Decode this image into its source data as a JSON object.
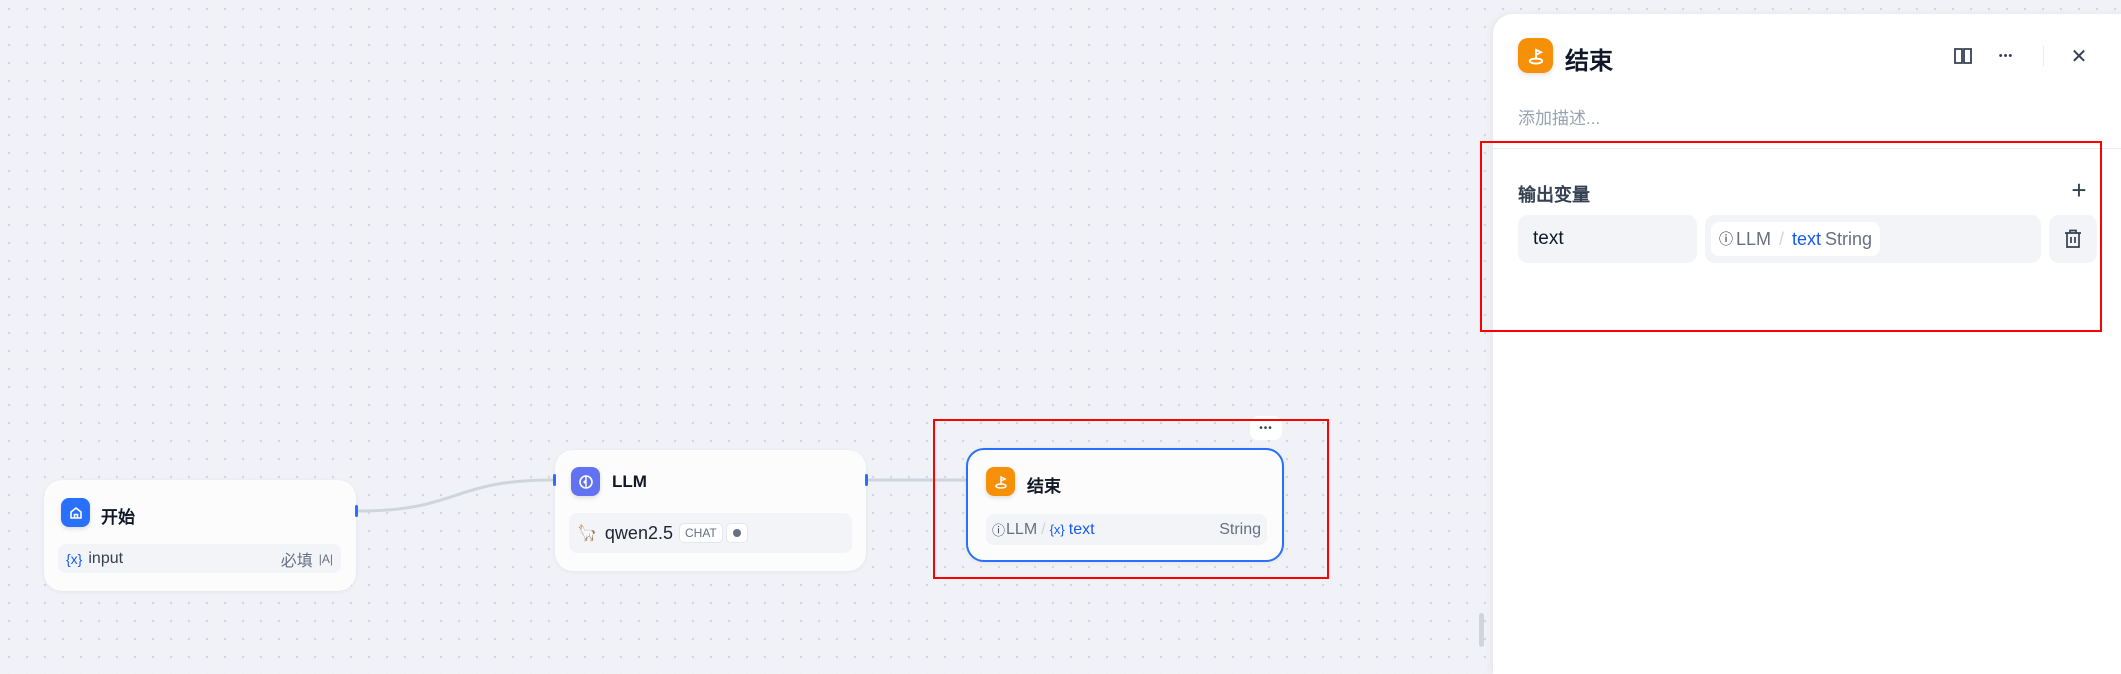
{
  "canvas": {
    "nodes": {
      "start": {
        "title": "开始",
        "icon": "home-icon",
        "color": "#2970ff",
        "variable": {
          "type_icon": "{x}",
          "name": "input",
          "required": "必填",
          "field_type_icon": "|A|"
        }
      },
      "llm": {
        "title": "LLM",
        "icon": "brain-icon",
        "color": "#6172f3",
        "model": {
          "name": "qwen2.5",
          "mode": "CHAT",
          "icon": "llama-icon"
        }
      },
      "end": {
        "title": "结束",
        "icon": "flag-icon",
        "color": "#f79009",
        "more": "•••",
        "output": {
          "source": "LLM",
          "sep": "/",
          "type_icon": "{x}",
          "name": "text",
          "type": "String"
        }
      }
    }
  },
  "panel": {
    "title": "结束",
    "description_placeholder": "添加描述...",
    "section_title": "输出变量",
    "add": "+",
    "close": "✕",
    "more": "•••",
    "outputs": [
      {
        "name": "text",
        "source": "LLM",
        "sep": "/",
        "var": "text",
        "type": "String"
      }
    ]
  },
  "colors": {
    "accent": "#2970ff",
    "highlight": "#ff0000",
    "end": "#f79009",
    "llm": "#6172f3"
  }
}
